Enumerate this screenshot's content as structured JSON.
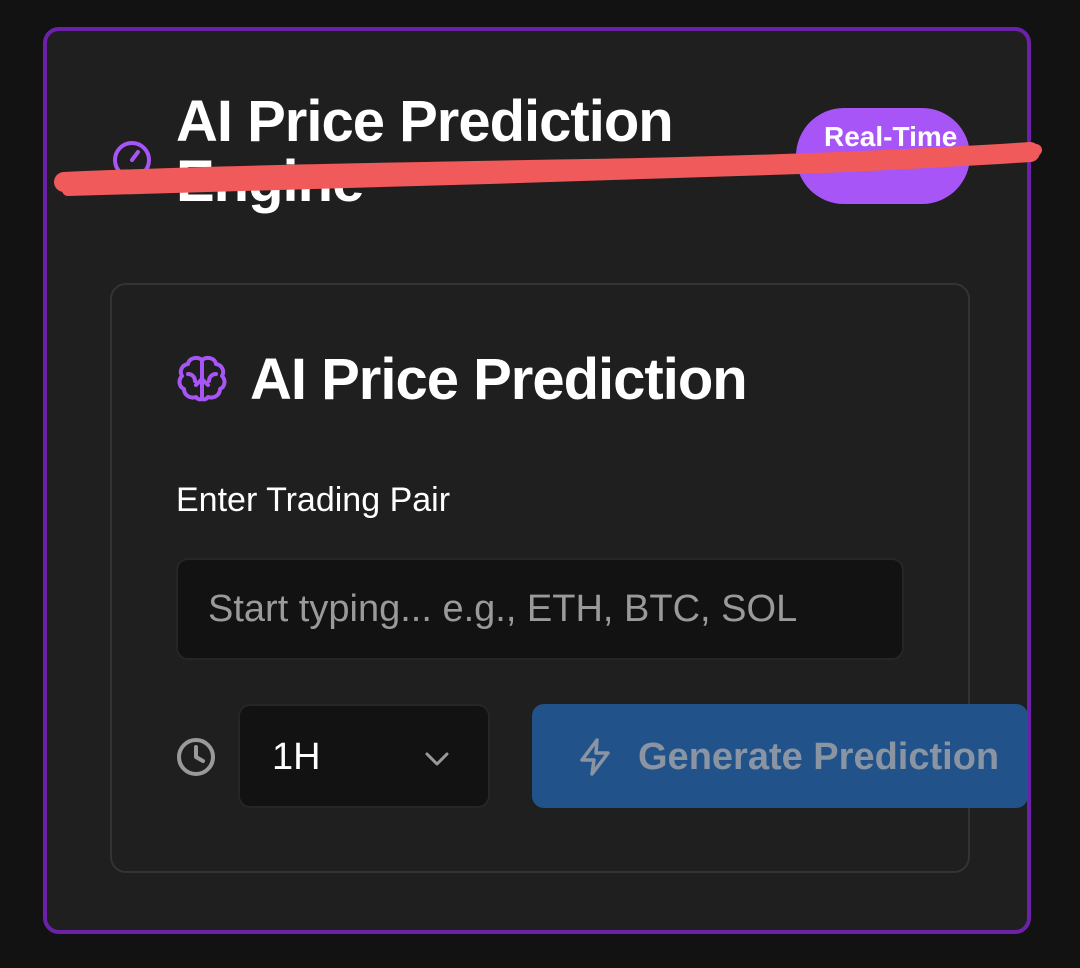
{
  "header": {
    "title": "AI Price Prediction Engine",
    "badge": "Real-Time",
    "accent_color": "#a855f7",
    "border_color": "#6b21a8",
    "icon": "timer-icon"
  },
  "card": {
    "title": "AI Price Prediction",
    "icon": "brain-icon"
  },
  "form": {
    "pair_label": "Enter Trading Pair",
    "pair_value": "",
    "pair_placeholder": "Start typing... e.g., ETH, BTC, SOL",
    "timeframe_icon": "clock-icon",
    "timeframe_value": "1H",
    "generate_label": "Generate Prediction",
    "generate_icon": "bolt-icon",
    "generate_color": "#21538a"
  },
  "annotation": {
    "color": "#f05a5a",
    "icon": "red-strike-scribble"
  }
}
